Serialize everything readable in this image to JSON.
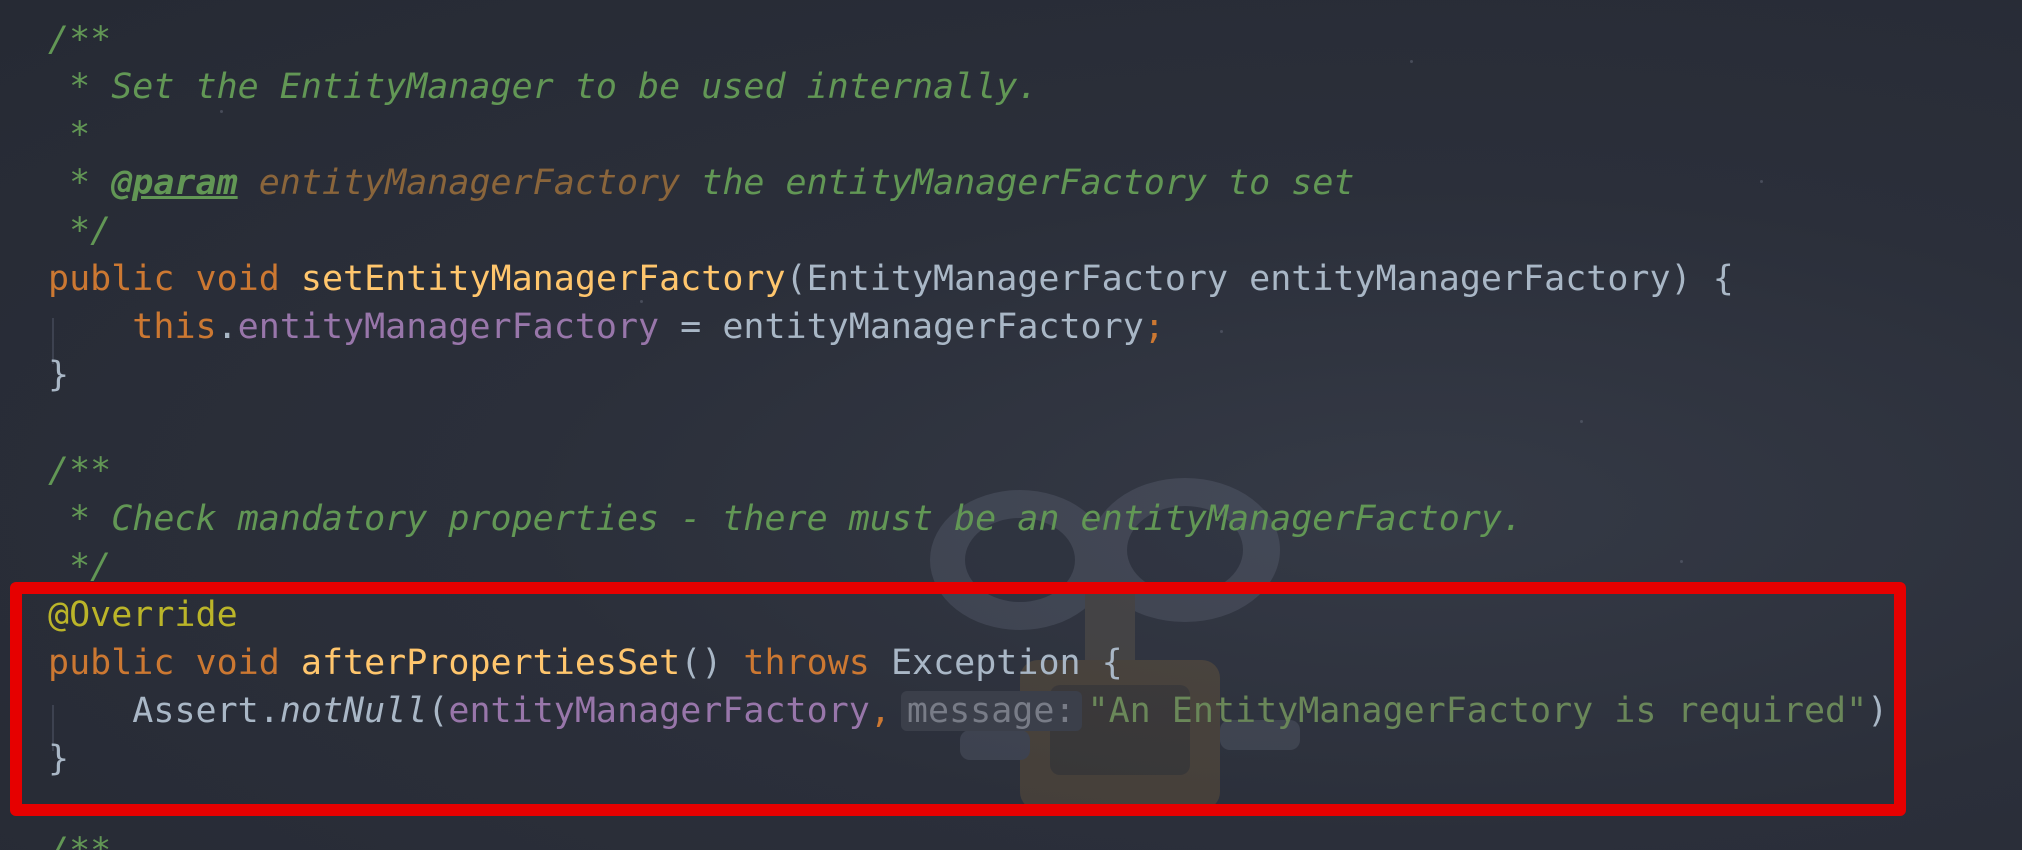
{
  "colors": {
    "background": "#2b2f3a",
    "comment": "#629755",
    "keyword": "#cc7832",
    "method": "#ffc66d",
    "field": "#9876aa",
    "annotation": "#bbb529",
    "string": "#6a8759",
    "text": "#a9b7c6",
    "highlight_border": "#e60000"
  },
  "code": {
    "doc1": {
      "open": "/**",
      "line1": " * Set the EntityManager to be used internally.",
      "line2": " *",
      "star": " * ",
      "tag": "@param",
      "param": "entityManagerFactory",
      "param_desc": " the entityManagerFactory to set",
      "close": " */"
    },
    "method1": {
      "kw_public": "public",
      "kw_void": "void",
      "name": "setEntityManagerFactory",
      "sig_rest": "(EntityManagerFactory entityManagerFactory) {",
      "this_kw": "this",
      "dot": ".",
      "field": "entityManagerFactory",
      "assign": " = entityManagerFactory",
      "semi": ";",
      "close": "}"
    },
    "doc2": {
      "open": "/**",
      "line1": " * Check mandatory properties - there must be an entityManagerFactory.",
      "close": " */"
    },
    "method2": {
      "annotation": "@Override",
      "kw_public": "public",
      "kw_void": "void",
      "name": "afterPropertiesSet",
      "parens": "()",
      "kw_throws": "throws",
      "exception": "Exception {",
      "assert_cls": "Assert.",
      "assert_fn": "notNull",
      "open_paren": "(",
      "arg_field": "entityManagerFactory",
      "comma": ",",
      "hint": "message:",
      "string": "\"An EntityManagerFactory is required\"",
      "close_paren": ")",
      "semi": ";",
      "close": "}"
    },
    "doc3": {
      "open": "/**"
    }
  }
}
